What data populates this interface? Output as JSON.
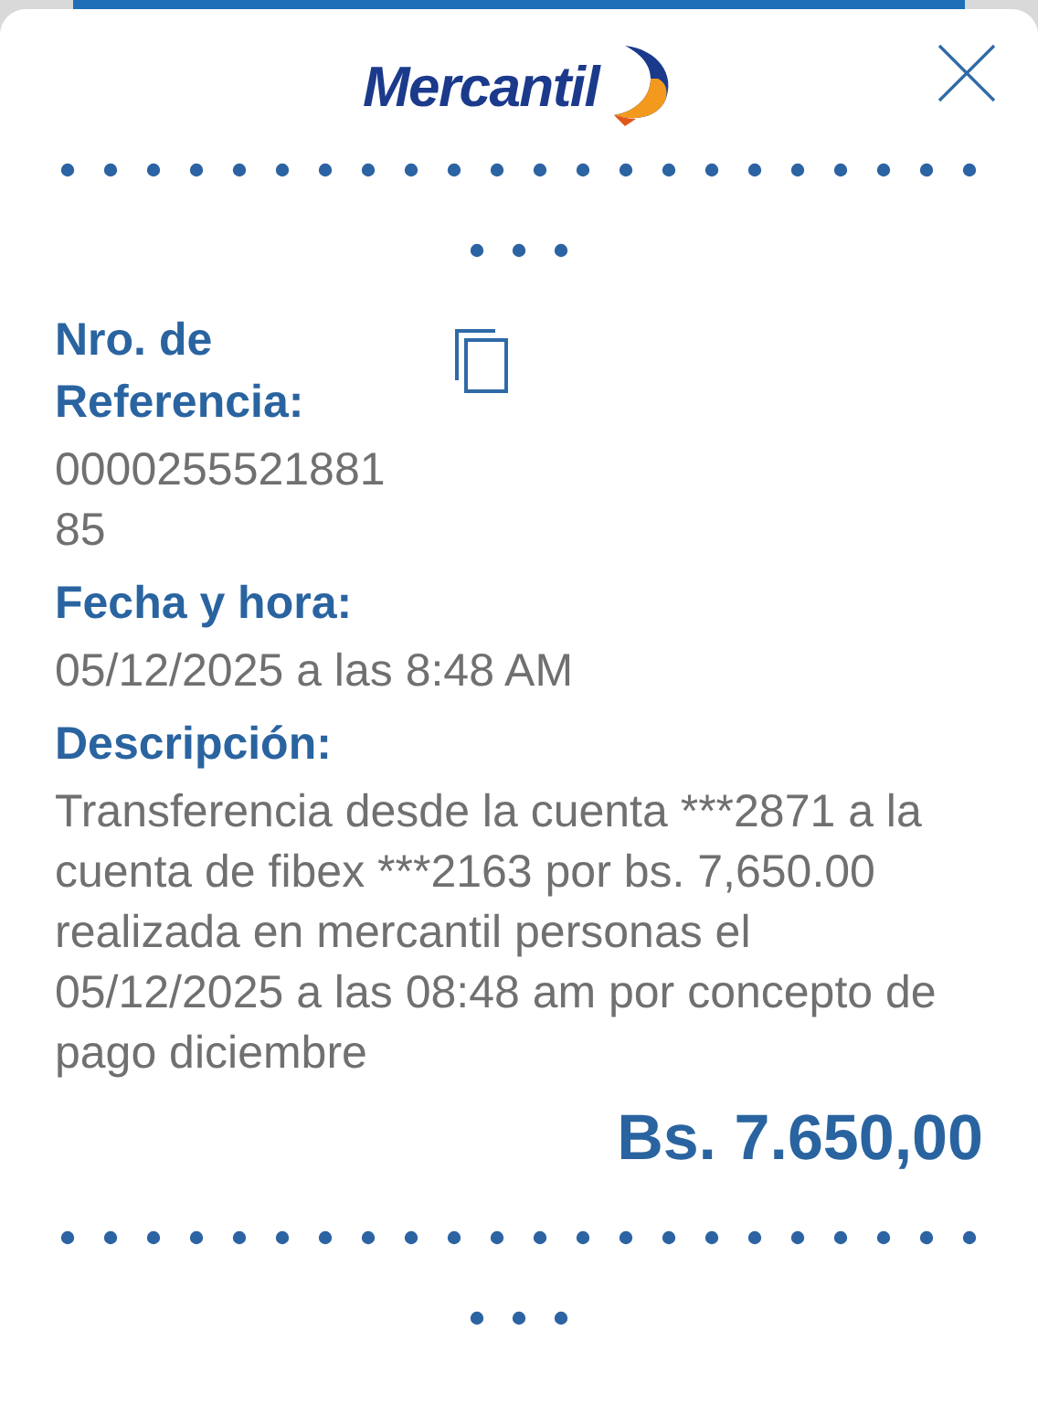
{
  "header": {
    "logo_text": "Mercantil"
  },
  "fields": [
    {
      "kind": "reference",
      "label": "Nro. de Referencia:",
      "value": "000025552188185"
    },
    {
      "kind": "plain",
      "label": "Fecha y hora:",
      "value": "05/12/2025 a las 8:48 AM"
    },
    {
      "kind": "plain",
      "label": "Descripción:",
      "value": "Transferencia desde la cuenta ***2871 a la cuenta de fibex ***2163 por bs. 7,650.00 realizada en mercantil personas el 05/12/2025 a las 08:48 am por concepto de pago diciembre"
    }
  ],
  "amount": "Bs. 7.650,00"
}
